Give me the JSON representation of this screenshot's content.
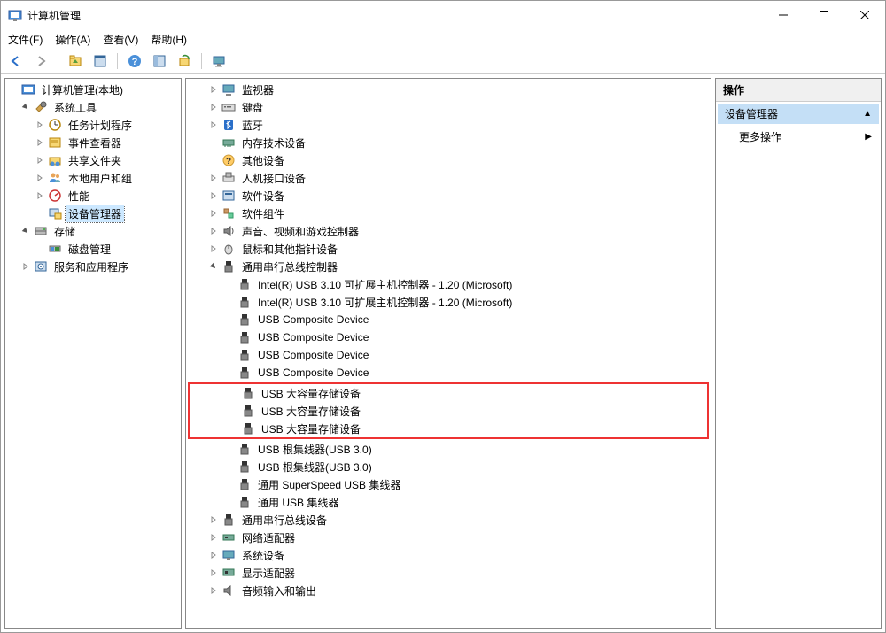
{
  "window": {
    "title": "计算机管理"
  },
  "menu": {
    "file": "文件(F)",
    "action": "操作(A)",
    "view": "查看(V)",
    "help": "帮助(H)"
  },
  "left_tree": {
    "root": "计算机管理(本地)",
    "system_tools": "系统工具",
    "task_scheduler": "任务计划程序",
    "event_viewer": "事件查看器",
    "shared_folders": "共享文件夹",
    "local_users": "本地用户和组",
    "performance": "性能",
    "device_manager": "设备管理器",
    "storage": "存储",
    "disk_mgmt": "磁盘管理",
    "services_apps": "服务和应用程序"
  },
  "mid_tree": {
    "monitors": "监视器",
    "keyboards": "键盘",
    "bluetooth": "蓝牙",
    "memory_devices": "内存技术设备",
    "other_devices": "其他设备",
    "hid": "人机接口设备",
    "software_devices": "软件设备",
    "software_components": "软件组件",
    "sound_video_game": "声音、视频和游戏控制器",
    "mice": "鼠标和其他指针设备",
    "usb_controllers": "通用串行总线控制器",
    "usb_items": [
      "Intel(R) USB 3.10 可扩展主机控制器 - 1.20 (Microsoft)",
      "Intel(R) USB 3.10 可扩展主机控制器 - 1.20 (Microsoft)",
      "USB Composite Device",
      "USB Composite Device",
      "USB Composite Device",
      "USB Composite Device"
    ],
    "usb_highlighted": [
      "USB 大容量存储设备",
      "USB 大容量存储设备",
      "USB 大容量存储设备"
    ],
    "usb_items_after": [
      "USB 根集线器(USB 3.0)",
      "USB 根集线器(USB 3.0)",
      "通用 SuperSpeed USB 集线器",
      "通用 USB 集线器"
    ],
    "usb_devices": "通用串行总线设备",
    "network_adapters": "网络适配器",
    "system_devices": "系统设备",
    "display_adapters": "显示适配器",
    "audio_io": "音频输入和输出"
  },
  "right_pane": {
    "header": "操作",
    "section_title": "设备管理器",
    "more_actions": "更多操作"
  }
}
